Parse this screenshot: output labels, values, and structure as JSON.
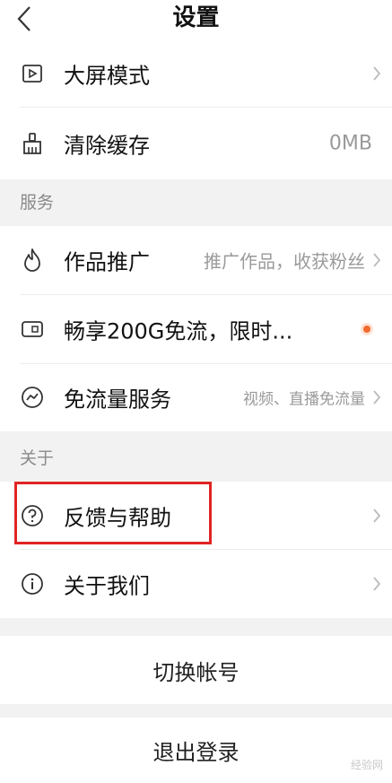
{
  "header": {
    "title": "设置"
  },
  "group1": {
    "items": [
      {
        "label": "大屏模式",
        "value": ""
      },
      {
        "label": "清除缓存",
        "value": "0MB"
      }
    ]
  },
  "section_services": "服务",
  "services": {
    "items": [
      {
        "label": "作品推广",
        "value": "推广作品，收获粉丝"
      },
      {
        "label": "畅享200G免流，限时...",
        "value": ""
      },
      {
        "label": "免流量服务",
        "value": "视频、直播免流量"
      }
    ]
  },
  "section_about": "关于",
  "about": {
    "items": [
      {
        "label": "反馈与帮助",
        "value": ""
      },
      {
        "label": "关于我们",
        "value": ""
      }
    ]
  },
  "buttons": {
    "switch_account": "切换帐号",
    "logout": "退出登录"
  },
  "watermark": "经验网",
  "colors": {
    "highlight": "#e02424",
    "accent_dot": "#f26a2e"
  }
}
